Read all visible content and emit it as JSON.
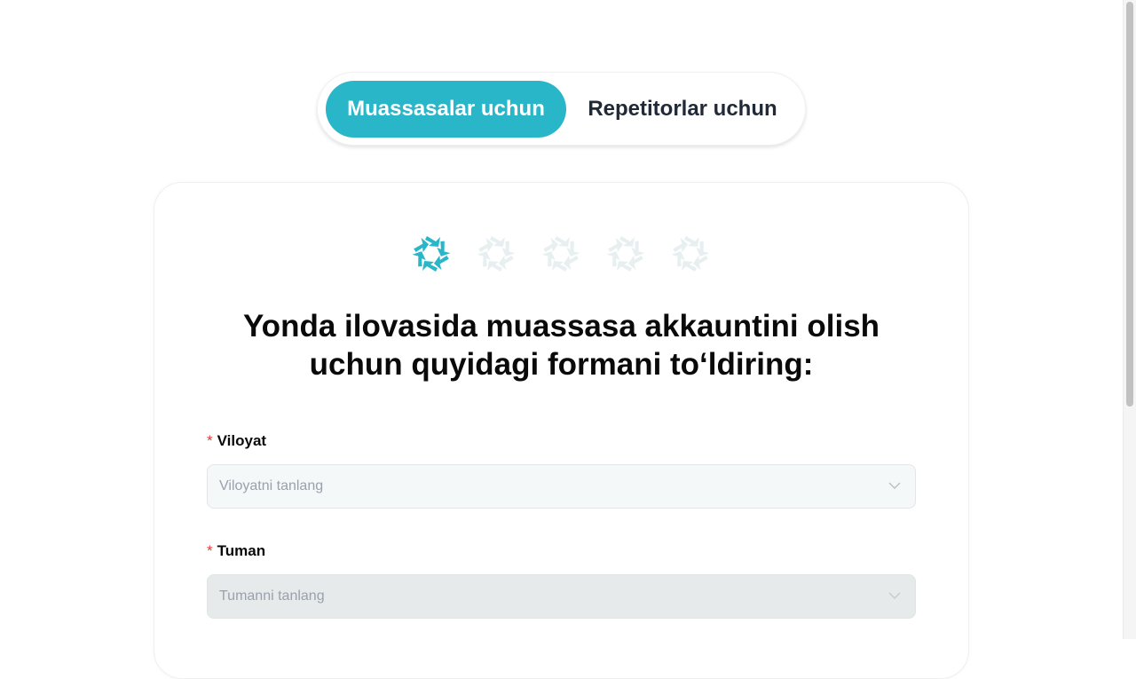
{
  "tabs": [
    {
      "label": "Muassasalar uchun",
      "active": true
    },
    {
      "label": "Repetitorlar uchun",
      "active": false
    }
  ],
  "steps": {
    "total": 5,
    "current": 1,
    "active_color": "#29b6c8",
    "inactive_color": "#e8eff1",
    "icon": "yonda-logo-icon"
  },
  "form": {
    "title_line1": "Yonda ilovasida muassasa akkauntini olish",
    "title_line2": "uchun quyidagi formani to‘ldiring:",
    "fields": [
      {
        "required_mark": "*",
        "label": "Viloyat",
        "placeholder": "Viloyatni tanlang",
        "disabled": false
      },
      {
        "required_mark": "*",
        "label": "Tuman",
        "placeholder": "Tumanni tanlang",
        "disabled": true
      }
    ]
  },
  "colors": {
    "accent": "#29b6c8",
    "required": "#e53935"
  }
}
